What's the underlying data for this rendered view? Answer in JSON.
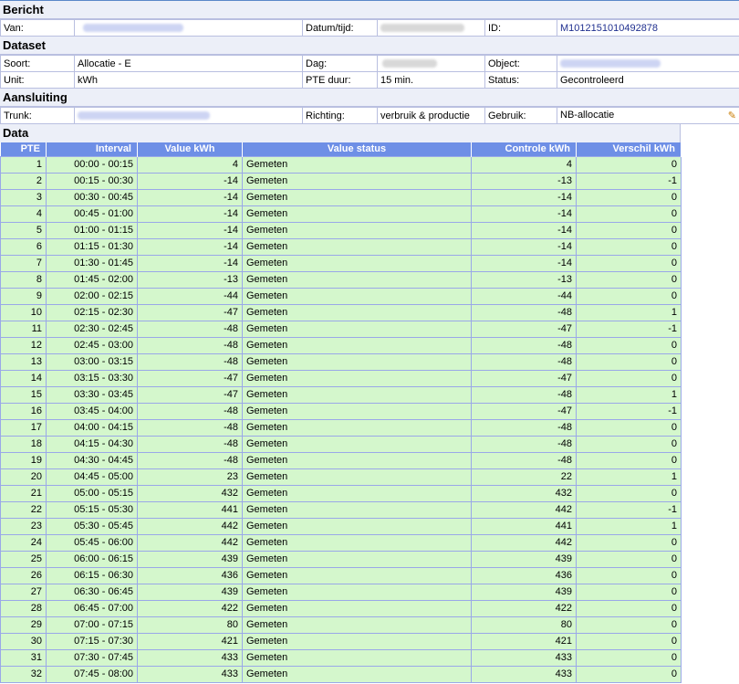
{
  "bericht": {
    "title": "Bericht",
    "van_label": "Van:",
    "datum_label": "Datum/tijd:",
    "id_label": "ID:",
    "id_value": "M1012151010492878"
  },
  "dataset": {
    "title": "Dataset",
    "soort_label": "Soort:",
    "soort_value": "Allocatie - E",
    "dag_label": "Dag:",
    "object_label": "Object:",
    "unit_label": "Unit:",
    "unit_value": "kWh",
    "pte_duur_label": "PTE duur:",
    "pte_duur_value": "15 min.",
    "status_label": "Status:",
    "status_value": "Gecontroleerd"
  },
  "aansluiting": {
    "title": "Aansluiting",
    "trunk_label": "Trunk:",
    "richting_label": "Richting:",
    "richting_value": "verbruik & productie",
    "gebruik_label": "Gebruik:",
    "gebruik_value": "NB-allocatie",
    "edit_icon": "pencil-icon"
  },
  "data": {
    "title": "Data",
    "columns": [
      "PTE",
      "Interval",
      "Value kWh",
      "Value status",
      "Controle kWh",
      "Verschil kWh"
    ],
    "rows": [
      [
        "1",
        "00:00 - 00:15",
        "4",
        "Gemeten",
        "4",
        "0"
      ],
      [
        "2",
        "00:15 - 00:30",
        "-14",
        "Gemeten",
        "-13",
        "-1"
      ],
      [
        "3",
        "00:30 - 00:45",
        "-14",
        "Gemeten",
        "-14",
        "0"
      ],
      [
        "4",
        "00:45 - 01:00",
        "-14",
        "Gemeten",
        "-14",
        "0"
      ],
      [
        "5",
        "01:00 - 01:15",
        "-14",
        "Gemeten",
        "-14",
        "0"
      ],
      [
        "6",
        "01:15 - 01:30",
        "-14",
        "Gemeten",
        "-14",
        "0"
      ],
      [
        "7",
        "01:30 - 01:45",
        "-14",
        "Gemeten",
        "-14",
        "0"
      ],
      [
        "8",
        "01:45 - 02:00",
        "-13",
        "Gemeten",
        "-13",
        "0"
      ],
      [
        "9",
        "02:00 - 02:15",
        "-44",
        "Gemeten",
        "-44",
        "0"
      ],
      [
        "10",
        "02:15 - 02:30",
        "-47",
        "Gemeten",
        "-48",
        "1"
      ],
      [
        "11",
        "02:30 - 02:45",
        "-48",
        "Gemeten",
        "-47",
        "-1"
      ],
      [
        "12",
        "02:45 - 03:00",
        "-48",
        "Gemeten",
        "-48",
        "0"
      ],
      [
        "13",
        "03:00 - 03:15",
        "-48",
        "Gemeten",
        "-48",
        "0"
      ],
      [
        "14",
        "03:15 - 03:30",
        "-47",
        "Gemeten",
        "-47",
        "0"
      ],
      [
        "15",
        "03:30 - 03:45",
        "-47",
        "Gemeten",
        "-48",
        "1"
      ],
      [
        "16",
        "03:45 - 04:00",
        "-48",
        "Gemeten",
        "-47",
        "-1"
      ],
      [
        "17",
        "04:00 - 04:15",
        "-48",
        "Gemeten",
        "-48",
        "0"
      ],
      [
        "18",
        "04:15 - 04:30",
        "-48",
        "Gemeten",
        "-48",
        "0"
      ],
      [
        "19",
        "04:30 - 04:45",
        "-48",
        "Gemeten",
        "-48",
        "0"
      ],
      [
        "20",
        "04:45 - 05:00",
        "23",
        "Gemeten",
        "22",
        "1"
      ],
      [
        "21",
        "05:00 - 05:15",
        "432",
        "Gemeten",
        "432",
        "0"
      ],
      [
        "22",
        "05:15 - 05:30",
        "441",
        "Gemeten",
        "442",
        "-1"
      ],
      [
        "23",
        "05:30 - 05:45",
        "442",
        "Gemeten",
        "441",
        "1"
      ],
      [
        "24",
        "05:45 - 06:00",
        "442",
        "Gemeten",
        "442",
        "0"
      ],
      [
        "25",
        "06:00 - 06:15",
        "439",
        "Gemeten",
        "439",
        "0"
      ],
      [
        "26",
        "06:15 - 06:30",
        "436",
        "Gemeten",
        "436",
        "0"
      ],
      [
        "27",
        "06:30 - 06:45",
        "439",
        "Gemeten",
        "439",
        "0"
      ],
      [
        "28",
        "06:45 - 07:00",
        "422",
        "Gemeten",
        "422",
        "0"
      ],
      [
        "29",
        "07:00 - 07:15",
        "80",
        "Gemeten",
        "80",
        "0"
      ],
      [
        "30",
        "07:15 - 07:30",
        "421",
        "Gemeten",
        "421",
        "0"
      ],
      [
        "31",
        "07:30 - 07:45",
        "433",
        "Gemeten",
        "433",
        "0"
      ],
      [
        "32",
        "07:45 - 08:00",
        "433",
        "Gemeten",
        "433",
        "0"
      ]
    ]
  }
}
